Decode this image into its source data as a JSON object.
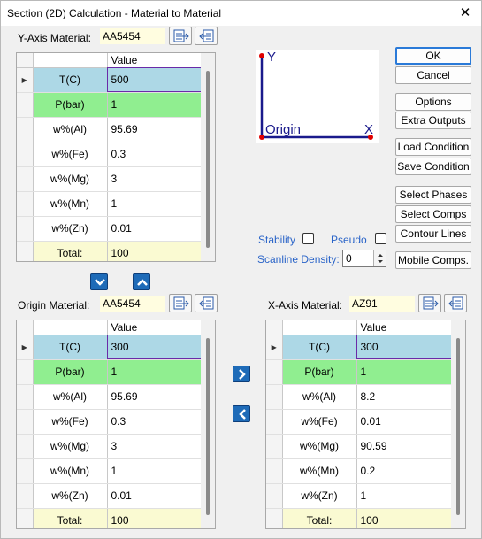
{
  "window": {
    "title": "Section (2D) Calculation - Material to Material",
    "close_glyph": "✕"
  },
  "y_axis": {
    "label": "Y-Axis Material:",
    "material": "AA5454",
    "value_header": "Value",
    "rows": [
      {
        "name": "T(C)",
        "value": "500"
      },
      {
        "name": "P(bar)",
        "value": "1"
      },
      {
        "name": "w%(Al)",
        "value": "95.69"
      },
      {
        "name": "w%(Fe)",
        "value": "0.3"
      },
      {
        "name": "w%(Mg)",
        "value": "3"
      },
      {
        "name": "w%(Mn)",
        "value": "1"
      },
      {
        "name": "w%(Zn)",
        "value": "0.01"
      },
      {
        "name": "Total:",
        "value": "100"
      }
    ]
  },
  "origin": {
    "label": "Origin Material:",
    "material": "AA5454",
    "value_header": "Value",
    "rows": [
      {
        "name": "T(C)",
        "value": "300"
      },
      {
        "name": "P(bar)",
        "value": "1"
      },
      {
        "name": "w%(Al)",
        "value": "95.69"
      },
      {
        "name": "w%(Fe)",
        "value": "0.3"
      },
      {
        "name": "w%(Mg)",
        "value": "3"
      },
      {
        "name": "w%(Mn)",
        "value": "1"
      },
      {
        "name": "w%(Zn)",
        "value": "0.01"
      },
      {
        "name": "Total:",
        "value": "100"
      }
    ]
  },
  "x_axis": {
    "label": "X-Axis Material:",
    "material": "AZ91",
    "value_header": "Value",
    "rows": [
      {
        "name": "T(C)",
        "value": "300"
      },
      {
        "name": "P(bar)",
        "value": "1"
      },
      {
        "name": "w%(Al)",
        "value": "8.2"
      },
      {
        "name": "w%(Fe)",
        "value": "0.01"
      },
      {
        "name": "w%(Mg)",
        "value": "90.59"
      },
      {
        "name": "w%(Mn)",
        "value": "0.2"
      },
      {
        "name": "w%(Zn)",
        "value": "1"
      },
      {
        "name": "Total:",
        "value": "100"
      }
    ]
  },
  "diagram": {
    "y_label": "Y",
    "x_label": "X",
    "origin_label": "Origin"
  },
  "buttons": {
    "ok": "OK",
    "cancel": "Cancel",
    "options": "Options",
    "extra_outputs": "Extra Outputs",
    "load_condition": "Load Condition",
    "save_condition": "Save Condition",
    "select_phases": "Select Phases",
    "select_comps": "Select Comps",
    "contour_lines": "Contour Lines",
    "mobile_comps": "Mobile Comps."
  },
  "options": {
    "stability": "Stability",
    "pseudo": "Pseudo",
    "scanline_density_label": "Scanline Density:",
    "scanline_density_value": "0"
  },
  "colors": {
    "temp_row": "#add8e6",
    "pressure_row": "#90ee90",
    "total_row": "#fafad2",
    "material_box": "#fffde0",
    "axis": "#1a1a8c",
    "point": "#e00000"
  },
  "icons": [
    "import-icon",
    "export-icon",
    "copy-down-icon",
    "copy-up-icon",
    "copy-right-icon",
    "copy-left-icon"
  ]
}
